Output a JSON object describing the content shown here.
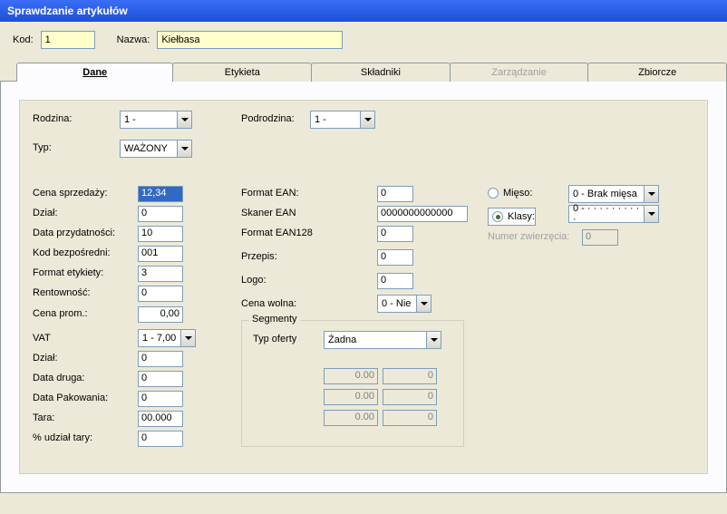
{
  "title": "Sprawdzanie artykułów",
  "header": {
    "kod_label": "Kod:",
    "kod_value": "1",
    "nazwa_label": "Nazwa:",
    "nazwa_value": "Kiełbasa"
  },
  "tabs": [
    "Dane",
    "Etykieta",
    "Składniki",
    "Zarządzanie",
    "Zbiorcze"
  ],
  "left": {
    "rodzina_label": "Rodzina:",
    "rodzina_value": "1 -",
    "typ_label": "Typ:",
    "typ_value": "WAŻONY",
    "cena_sprzedazy_label": "Cena sprzedaży:",
    "cena_sprzedazy_value": "12,34",
    "dzial_label": "Dział:",
    "dzial_value": "0",
    "data_przydatnosci_label": "Data przydatności:",
    "data_przydatnosci_value": "10",
    "kod_bezposredni_label": "Kod bezpośredni:",
    "kod_bezposredni_value": "001",
    "format_etykiety_label": "Format etykiety:",
    "format_etykiety_value": "3",
    "rentownosc_label": "Rentowność:",
    "rentownosc_value": "0",
    "cena_prom_label": "Cena prom.:",
    "cena_prom_value": "0,00",
    "vat_label": "VAT",
    "vat_value": "1 - 7,00",
    "dzial2_label": "Dział:",
    "dzial2_value": "0",
    "data_druga_label": "Data druga:",
    "data_druga_value": "0",
    "data_pakowania_label": "Data Pakowania:",
    "data_pakowania_value": "0",
    "tara_label": "Tara:",
    "tara_value": "00.000",
    "udzial_tary_label": "% udział tary:",
    "udzial_tary_value": "0"
  },
  "mid": {
    "podrodzina_label": "Podrodzina:",
    "podrodzina_value": "1 -",
    "format_ean_label": "Format EAN:",
    "format_ean_value": "0",
    "skaner_ean_label": "Skaner EAN",
    "skaner_ean_value": "0000000000000",
    "format_ean128_label": "Format EAN128",
    "format_ean128_value": "0",
    "przepis_label": "Przepis:",
    "przepis_value": "0",
    "logo_label": "Logo:",
    "logo_value": "0",
    "cena_wolna_label": "Cena wolna:",
    "cena_wolna_value": "0 - Nie"
  },
  "right": {
    "mieso_label": "Mięso:",
    "klasy_label": "Klasy:",
    "mieso_sel": "0 - Brak mięsa",
    "klasy_sel": "0 - · · · · · · · · · ·",
    "numer_zwierzecia_label": "Numer zwierzęcia:",
    "numer_zwierzecia_value": "0"
  },
  "segmenty": {
    "title": "Segmenty",
    "typ_oferty_label": "Typ oferty",
    "typ_oferty_value": "Żadna",
    "rows": [
      {
        "a": "0.00",
        "b": "0"
      },
      {
        "a": "0.00",
        "b": "0"
      },
      {
        "a": "0.00",
        "b": "0"
      }
    ]
  }
}
